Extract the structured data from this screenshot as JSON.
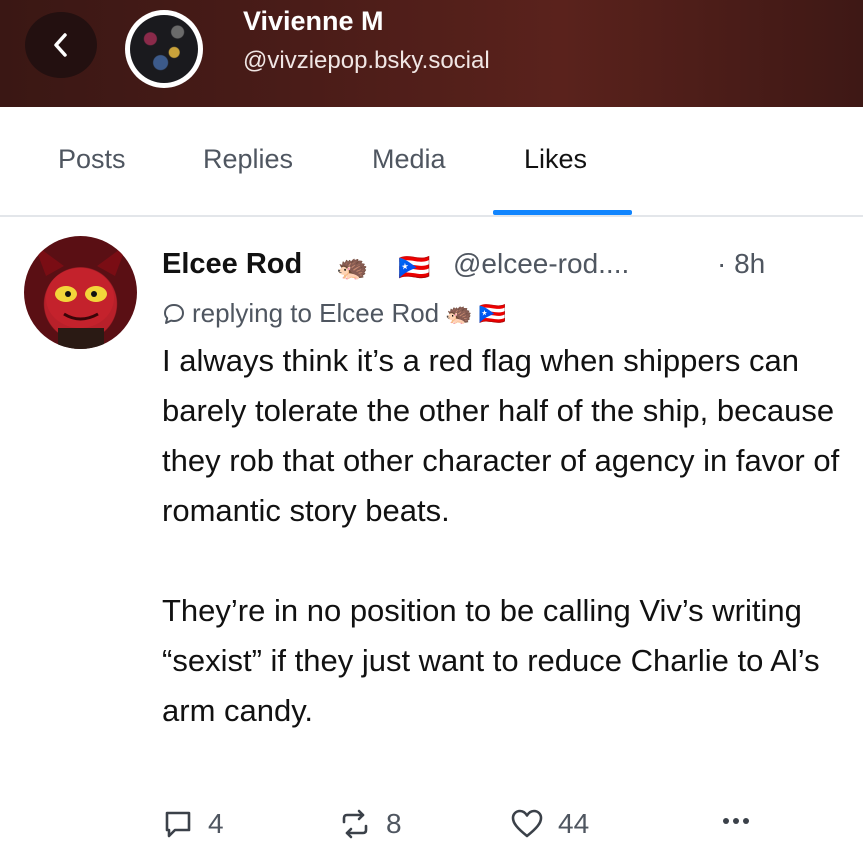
{
  "header": {
    "name": "Vivienne M",
    "handle": "@vivziepop.bsky.social"
  },
  "tabs": [
    {
      "label": "Posts"
    },
    {
      "label": "Replies"
    },
    {
      "label": "Media"
    },
    {
      "label": "Likes",
      "active": true
    }
  ],
  "post": {
    "author_name": "Elcee Rod",
    "author_emoji_1": "🦔",
    "author_emoji_2": "🇵🇷",
    "handle": "@elcee-rod....",
    "time": "· 8h",
    "reply_text": "replying to Elcee Rod",
    "body": "I always think it’s a red flag when shippers can barely tolerate the other half of the ship, because they rob that other character of agency in favor of romantic story beats.\n\nThey’re in no position to be calling Viv’s writing “sexist” if they just want to reduce Charlie to Al’s arm candy.",
    "reply_count": "4",
    "repost_count": "8",
    "like_count": "44"
  },
  "colors": {
    "header_bg": "#4a1c18",
    "accent": "#1185fe",
    "muted_text": "#4f5660"
  },
  "icons": [
    "chevron-left-icon",
    "reply-bubble-icon",
    "comment-icon",
    "repost-icon",
    "heart-icon",
    "ellipsis-icon"
  ]
}
